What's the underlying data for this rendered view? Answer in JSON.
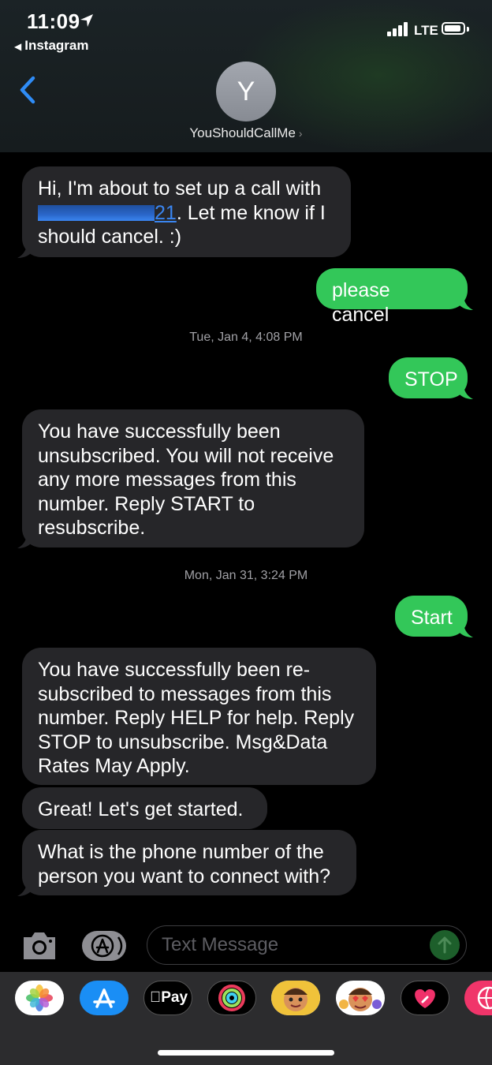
{
  "status_bar": {
    "time": "11:09",
    "back_app": "Instagram",
    "network": "LTE"
  },
  "header": {
    "avatar_initial": "Y",
    "contact_name": "YouShouldCallMe"
  },
  "messages": [
    {
      "kind": "in",
      "text_before": "Hi, I'm about to set up a call with ",
      "redacted_tail": "21",
      "text_after": ". Let me know if I should cancel. :)"
    },
    {
      "kind": "out",
      "text": "please cancel"
    },
    {
      "kind": "timestamp",
      "day": "Tue, Jan 4,",
      "time": "4:08 PM"
    },
    {
      "kind": "out",
      "text": "STOP"
    },
    {
      "kind": "in",
      "text": "You have successfully been unsubscribed. You will not receive any more messages from this number. Reply START to resubscribe."
    },
    {
      "kind": "timestamp",
      "day": "Mon, Jan 31,",
      "time": "3:24 PM"
    },
    {
      "kind": "out",
      "text": "Start"
    },
    {
      "kind": "in",
      "text": "You have successfully been re-subscribed to messages from this number. Reply HELP for help. Reply STOP to unsubscribe. Msg&Data Rates May Apply."
    },
    {
      "kind": "in",
      "text": "Great! Let's get started."
    },
    {
      "kind": "in",
      "text": "What is the phone number of the person you want to connect with?"
    }
  ],
  "composer": {
    "placeholder": "Text Message"
  },
  "app_drawer": {
    "apple_pay_label": "Pay",
    "apps": [
      "photos-icon",
      "app-store-icon",
      "apple-pay-icon",
      "activity-icon",
      "memoji-icon",
      "memoji-stickers-icon",
      "digital-touch-icon",
      "web-images-icon"
    ]
  },
  "colors": {
    "outgoing_bubble": "#33c759",
    "incoming_bubble": "#262629",
    "link_blue": "#3a85f0",
    "background": "#000000"
  }
}
